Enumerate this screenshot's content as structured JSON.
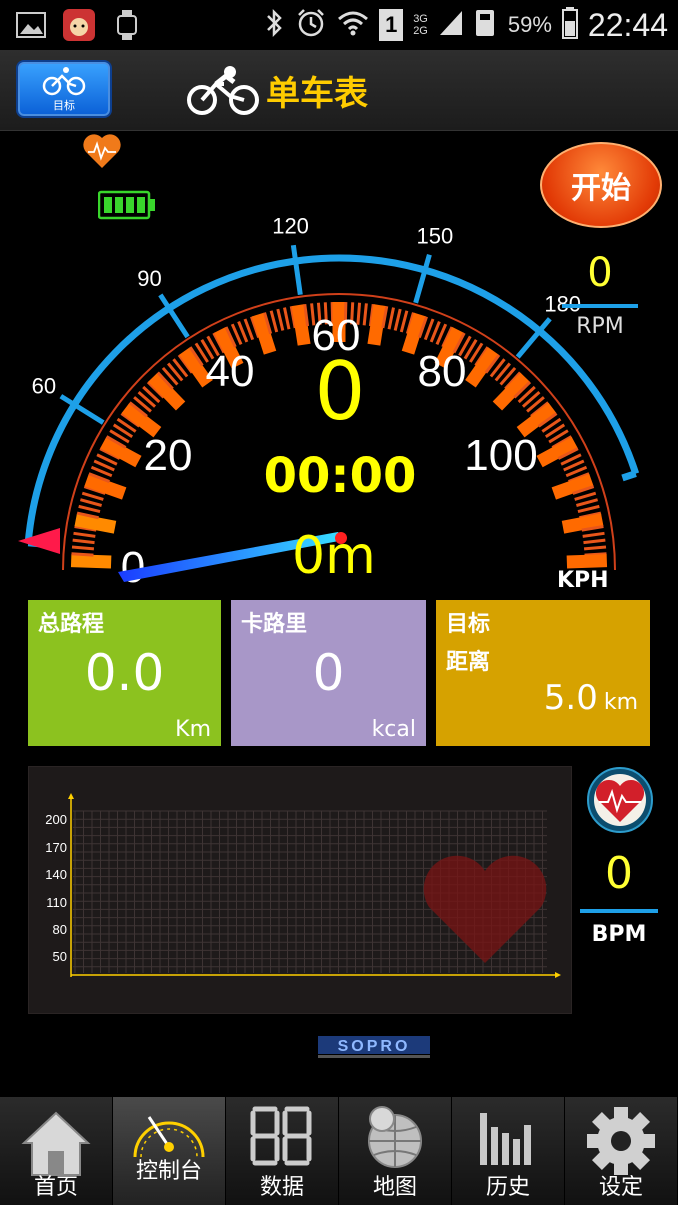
{
  "status_bar": {
    "battery": "59%",
    "time": "22:44",
    "sim_slot": "1",
    "net_top": "3G",
    "net_bottom": "2G"
  },
  "header": {
    "target_button_label": "目标",
    "title": "单车表"
  },
  "gauge": {
    "outer_ticks": [
      "60",
      "90",
      "120",
      "150",
      "180"
    ],
    "inner_ticks": [
      "0",
      "20",
      "40",
      "60",
      "80",
      "100"
    ],
    "speed": "0",
    "timer": "00:00",
    "distance": "0m",
    "speed_unit": "KPH",
    "start_button": "开始",
    "rpm_value": "0",
    "rpm_label": "RPM"
  },
  "tiles": {
    "total_distance": {
      "title": "总路程",
      "value": "0.0",
      "unit": "Km"
    },
    "calories": {
      "title": "卡路里",
      "value": "0",
      "unit": "kcal"
    },
    "target": {
      "title": "目标",
      "subtitle": "距离",
      "value": "5.0",
      "unit": "km"
    }
  },
  "heart_chart": {
    "y_ticks": [
      "200",
      "170",
      "140",
      "110",
      "80",
      "50"
    ],
    "bpm_value": "0",
    "bpm_label": "BPM"
  },
  "logo": "SOPRO",
  "nav": [
    {
      "label": "首页",
      "icon": "home-icon"
    },
    {
      "label": "控制台",
      "icon": "gauge-icon"
    },
    {
      "label": "数据",
      "icon": "digits-icon"
    },
    {
      "label": "地图",
      "icon": "globe-icon"
    },
    {
      "label": "历史",
      "icon": "bars-icon"
    },
    {
      "label": "设定",
      "icon": "gear-icon"
    }
  ],
  "colors": {
    "accent_yellow": "#ffff00",
    "arc_blue": "#1ea0e8",
    "tile_green": "#8cc21f",
    "tile_purple": "#a897c8",
    "tile_gold": "#d6a200"
  }
}
